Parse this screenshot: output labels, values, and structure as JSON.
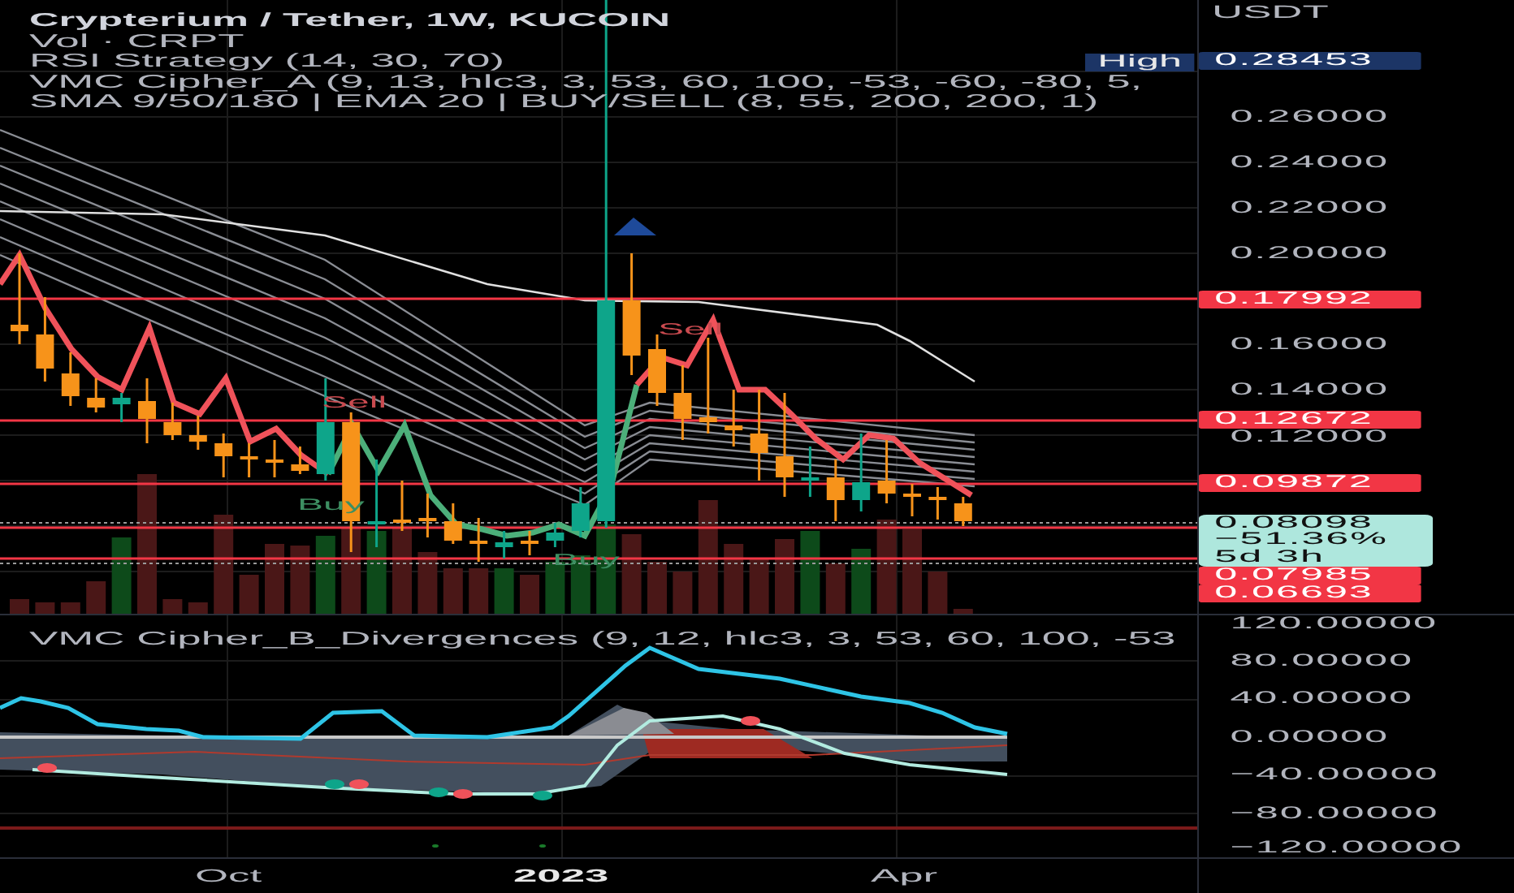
{
  "legend": [
    {
      "text": "Crypterium / Tether, 1W, KUCOIN",
      "kind": "title"
    },
    {
      "text": "Vol · CRPT",
      "kind": "study"
    },
    {
      "text": "RSI Strategy (14, 30, 70)",
      "kind": "study"
    },
    {
      "text": "VMC Cipher_A (9, 13, hlc3, 3, 53, 60, 100, -53, -60, -80, 5,",
      "kind": "study"
    },
    {
      "text": "SMA 9/50/180 | EMA 20 | BUY/SELL (8, 55, 200, 200, 1)",
      "kind": "study"
    }
  ],
  "high_label": "High",
  "signals": [
    {
      "text": "Sell",
      "kind": "sell"
    },
    {
      "text": "Sell",
      "kind": "sell"
    },
    {
      "text": "Buy",
      "kind": "buy"
    },
    {
      "text": "Buy",
      "kind": "buy"
    }
  ],
  "price_axis": {
    "unit": "USDT",
    "labels": [
      {
        "text": "0.28453",
        "kind": "high"
      },
      {
        "text": "0.26000",
        "kind": "tick"
      },
      {
        "text": "0.24000",
        "kind": "tick"
      },
      {
        "text": "0.22000",
        "kind": "tick"
      },
      {
        "text": "0.20000",
        "kind": "tick"
      },
      {
        "text": "0.17992",
        "kind": "level"
      },
      {
        "text": "0.16000",
        "kind": "tick"
      },
      {
        "text": "0.14000",
        "kind": "tick"
      },
      {
        "text": "0.12672",
        "kind": "level"
      },
      {
        "text": "0.12000",
        "kind": "tick"
      },
      {
        "text": "0.09872",
        "kind": "level"
      },
      {
        "text": "0.08098",
        "kind": "last",
        "change": "−51.36%",
        "countdown": "5d 3h"
      },
      {
        "text": "0.07985",
        "kind": "level"
      },
      {
        "text": "0.06693",
        "kind": "level"
      }
    ]
  },
  "oscillator": {
    "legend": "VMC Cipher_B_Divergences (9, 12, hlc3, 3, 53, 60, 100, -53",
    "axis": [
      "120.00000",
      "80.00000",
      "40.00000",
      "0.00000",
      "−40.00000",
      "−80.00000",
      "−120.00000"
    ]
  },
  "time_axis": [
    {
      "text": "Oct",
      "kind": "month"
    },
    {
      "text": "2023",
      "kind": "year"
    },
    {
      "text": "Apr",
      "kind": "month"
    }
  ]
}
